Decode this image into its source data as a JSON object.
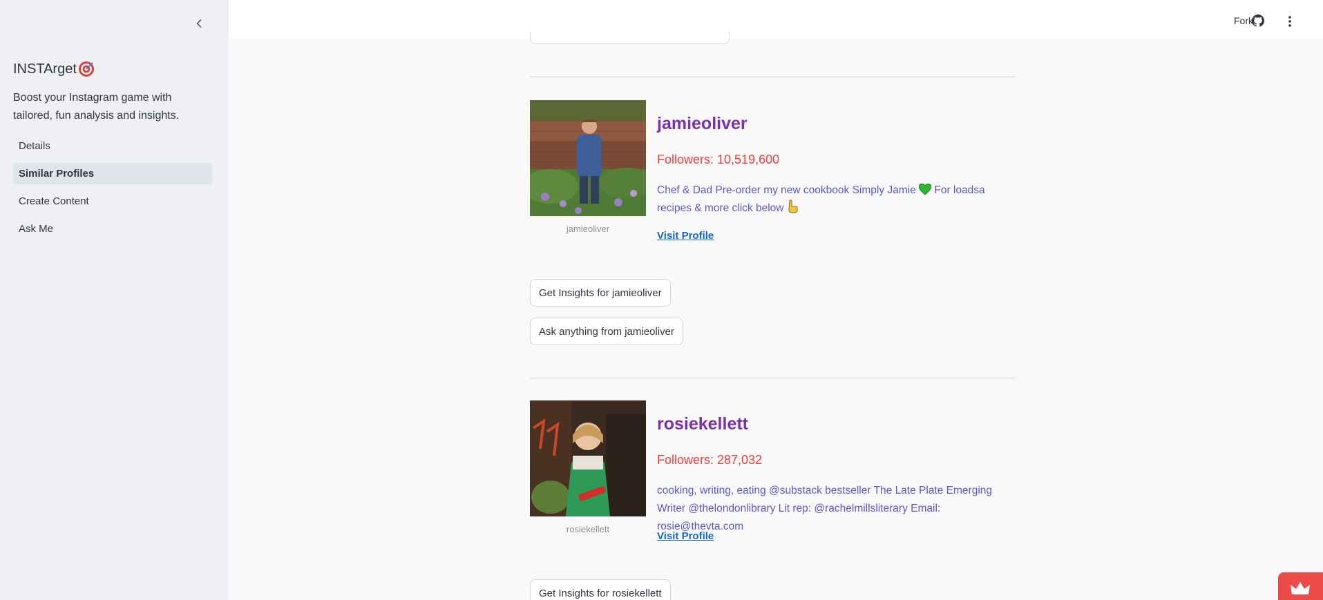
{
  "sidebar": {
    "app_name": "INSTArget",
    "description": "Boost your Instagram game with tailored, fun analysis and insights.",
    "nav": [
      {
        "label": "Details",
        "active": false
      },
      {
        "label": "Similar Profiles",
        "active": true
      },
      {
        "label": "Create Content",
        "active": false
      },
      {
        "label": "Ask Me",
        "active": false
      }
    ]
  },
  "header": {
    "fork_label": "Fork",
    "icons": [
      "github-icon",
      "more-vertical-icon"
    ]
  },
  "profiles": [
    {
      "username": "jamieoliver",
      "caption": "jamieoliver",
      "followers": "Followers: 10,519,600",
      "bio_part1": "Chef & Dad Pre-order my new cookbook Simply Jamie",
      "bio_part2": "For loadsa recipes & more click below",
      "visit_label": "Visit Profile",
      "insights_button": "Get Insights for jamieoliver",
      "ask_button": "Ask anything from jamieoliver"
    },
    {
      "username": "rosiekellett",
      "caption": "rosiekellett",
      "followers": "Followers: 287,032",
      "bio": "cooking, writing, eating @substack bestseller The Late Plate Emerging Writer @thelondonlibrary Lit rep: @rachelmillsliterary Email: rosie@thevta.com",
      "visit_label": "Visit Profile",
      "insights_button": "Get Insights for rosiekellett"
    }
  ],
  "colors": {
    "username": "#7b2fa9",
    "followers": "#ef3b3b",
    "bio": "#5a58c6",
    "link": "#1566c0",
    "sidebar_bg": "#eef0f4",
    "accent_badge": "#ef4a4a"
  }
}
